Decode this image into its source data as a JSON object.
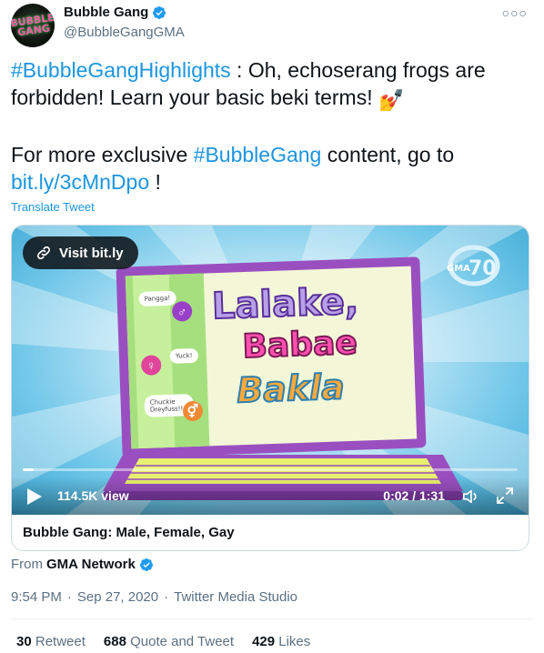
{
  "author": {
    "display_name": "Bubble Gang",
    "handle": "@BubbleGangGMA",
    "avatar_text_top": "BUBBLE",
    "avatar_text_bottom": "GANG"
  },
  "more_icon": "more-horizontal-icon",
  "tweet": {
    "hashtag_1": "#BubbleGangHighlights",
    "line_1": " : Oh, echoserang frogs are forbidden! Learn your basic beki terms! ",
    "emoji_1": "💅",
    "line_2_prefix": "For more exclusive ",
    "hashtag_2": "#BubbleGang",
    "line_2_suffix": " content, go to",
    "link": "bit.ly/3cMnDpo",
    "link_suffix": " !"
  },
  "translate_label": "Translate Tweet",
  "card": {
    "visit_label": "Visit bit.ly",
    "views": "114.5K view",
    "time": "0:02 / 1:31",
    "progress_fraction": 0.022,
    "title": "Bubble Gang: Male, Female, Gay",
    "video_text": {
      "word_1": "Lalake,",
      "word_2": "Babae",
      "word_3": "Bakla",
      "tag_1": "Pangga!",
      "tag_2": "Yuck!",
      "tag_3": "Chuckie Dreyfuss!!",
      "logo": "GMA"
    }
  },
  "source": {
    "from_label": "From ",
    "name": "GMA Network"
  },
  "meta": {
    "time": "9:54 PM",
    "sep_1": "·",
    "date": "Sep 27, 2020",
    "sep_2": "·",
    "client": "Twitter Media Studio"
  },
  "stats": {
    "retweets": "30",
    "retweets_label": " Retweet",
    "quotes": "688",
    "quotes_label": " Quote and Tweet",
    "likes": "429",
    "likes_label": " Likes"
  },
  "colors": {
    "accent": "#1b95e0",
    "verified": "#1d9bf0",
    "muted": "#5b7083"
  }
}
